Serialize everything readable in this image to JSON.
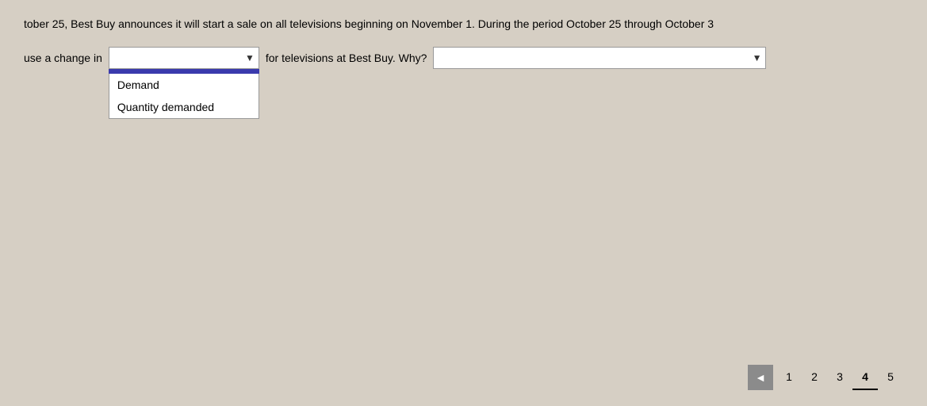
{
  "question": {
    "intro_text": "tober 25, Best Buy announces it will start a sale on all televisions beginning on November 1. During the period October 25 through October 3",
    "label_before": "use a  change in",
    "dropdown1": {
      "options": [
        "",
        "Demand",
        "Quantity demanded"
      ],
      "selected": "",
      "placeholder": ""
    },
    "label_middle": "for televisions at Best Buy. Why?",
    "dropdown2": {
      "options": [
        ""
      ],
      "selected": "",
      "placeholder": ""
    },
    "dropdown1_items": [
      {
        "label": "Demand"
      },
      {
        "label": "Quantity demanded"
      }
    ]
  },
  "pagination": {
    "prev_icon": "◄",
    "pages": [
      "1",
      "2",
      "3",
      "4",
      "5"
    ],
    "active_page": "4"
  }
}
